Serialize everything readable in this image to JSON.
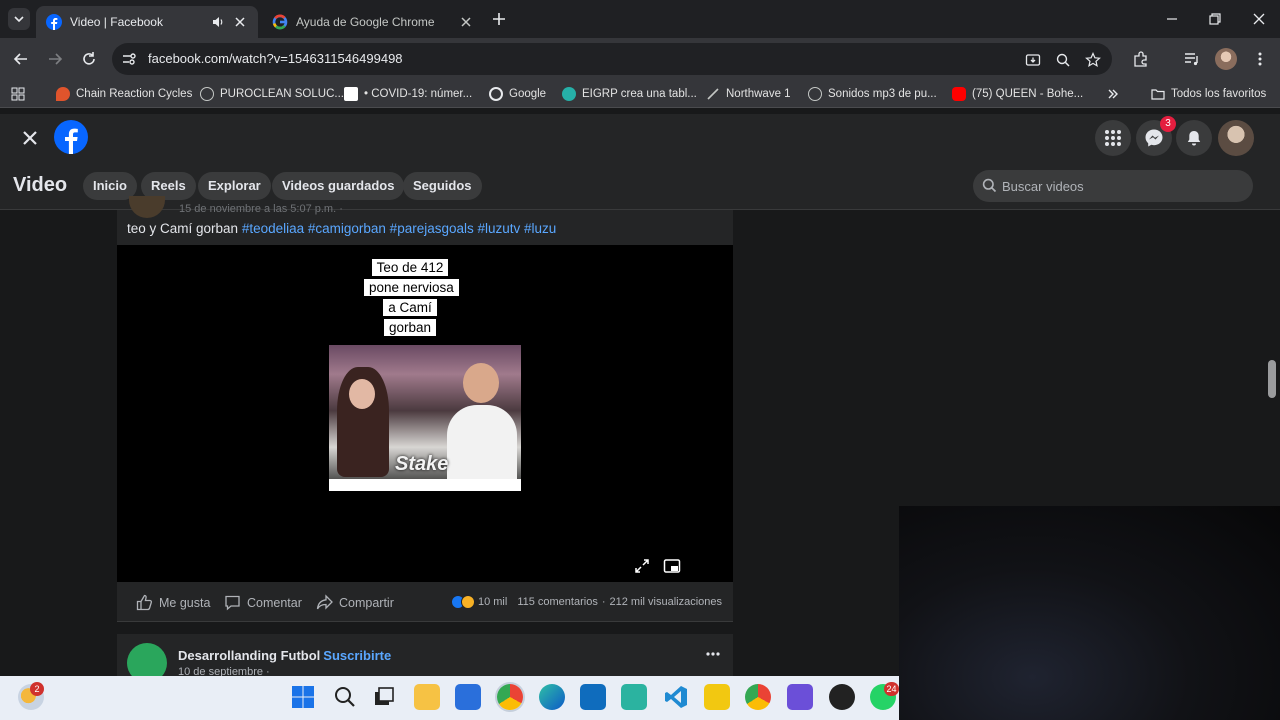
{
  "browser": {
    "tabs": [
      {
        "title": "Video | Facebook",
        "active": true
      },
      {
        "title": "Ayuda de Google Chrome",
        "active": false
      }
    ],
    "url": "facebook.com/watch?v=1546311546499498",
    "bookmarks": [
      {
        "label": "Chain Reaction Cycles",
        "icon": "flame-icon",
        "color": "#e0542c"
      },
      {
        "label": "PUROCLEAN SOLUC...",
        "icon": "globe-icon",
        "color": "#c4c7c5"
      },
      {
        "label": "• COVID-19: númer...",
        "icon": "bookmark-doc-icon",
        "color": "#ffffff"
      },
      {
        "label": "Google",
        "icon": "google-icon",
        "color": "#ffffff"
      },
      {
        "label": "EIGRP crea una tabl...",
        "icon": "cisco-icon",
        "color": "#26b0a8"
      },
      {
        "label": "Northwave 1",
        "icon": "check-icon",
        "color": "#c4c7c5"
      },
      {
        "label": "Sonidos mp3 de pu...",
        "icon": "globe-icon",
        "color": "#c4c7c5"
      },
      {
        "label": "(75) QUEEN - Bohe...",
        "icon": "youtube-icon",
        "color": "#ff0000"
      }
    ],
    "all_bookmarks": "Todos los favoritos"
  },
  "facebook": {
    "messenger_badge": "3",
    "nav_title": "Video",
    "nav_items": [
      "Inicio",
      "Reels",
      "Explorar",
      "Videos guardados",
      "Seguidos"
    ],
    "search_placeholder": "Buscar videos",
    "post": {
      "date_faded": "15 de noviembre a las 5:07 p.m. ·",
      "caption": "teo y Camí gorban",
      "hashtags": "#teodeliaa #camigorban #parejasgoals #luzutv #luzu",
      "video_overlay_text": "Teo de 412 pone nerviosa a Camí gorban",
      "thumbnail_brand": "Stake",
      "actions": {
        "like": "Me gusta",
        "comment": "Comentar",
        "share": "Compartir"
      },
      "reactions_count": "10 mil",
      "comments": "115 comentarios",
      "views": "212 mil visualizaciones"
    },
    "next_post": {
      "page_name": "Desarrollanding Futbol",
      "subscribe": "Suscribirte",
      "date": "10 de septiembre ·"
    }
  },
  "taskbar": {
    "weather_badge": "2",
    "whatsapp_badge": "24"
  },
  "colors": {
    "facebook_blue": "#0866ff",
    "hashtag": "#5aa7ff",
    "badge_red": "#e41e3f"
  }
}
